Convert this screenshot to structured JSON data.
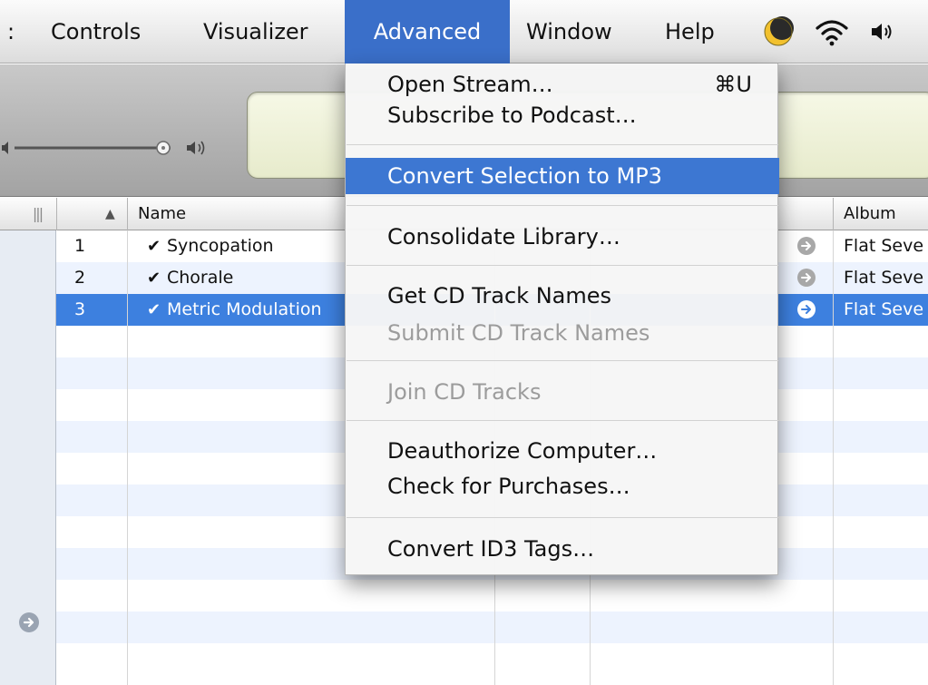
{
  "menubar": {
    "partial_item": ":",
    "items": [
      "Controls",
      "Visualizer",
      "Advanced",
      "Window",
      "Help"
    ],
    "active_item": "Advanced",
    "status_icons": [
      "eclipse-menu-icon",
      "wifi-icon",
      "volume-icon"
    ]
  },
  "advanced_menu": {
    "open_stream": {
      "label": "Open Stream…",
      "shortcut": "⌘U"
    },
    "subscribe_podcast": {
      "label": "Subscribe to Podcast…"
    },
    "convert_selection": {
      "label": "Convert Selection to MP3",
      "highlighted": true
    },
    "consolidate_library": {
      "label": "Consolidate Library…"
    },
    "get_cd_track_names": {
      "label": "Get CD Track Names"
    },
    "submit_cd_track_names": {
      "label": "Submit CD Track Names",
      "disabled": true
    },
    "join_cd_tracks": {
      "label": "Join CD Tracks",
      "disabled": true
    },
    "deauthorize": {
      "label": "Deauthorize Computer…"
    },
    "check_purchases": {
      "label": "Check for Purchases…"
    },
    "convert_id3": {
      "label": "Convert ID3 Tags…"
    }
  },
  "track_list": {
    "columns": {
      "sort_indicator": "▲",
      "name": "Name",
      "album": "Album"
    },
    "rows": [
      {
        "num": "1",
        "checked": "✔",
        "name": "Syncopation",
        "album": "Flat Seve"
      },
      {
        "num": "2",
        "checked": "✔",
        "name": "Chorale",
        "album": "Flat Seve"
      },
      {
        "num": "3",
        "checked": "✔",
        "name": "Metric Modulation",
        "album": "Flat Seve",
        "selected": true
      }
    ]
  },
  "colors": {
    "menu_highlight": "#3d77d2",
    "selected_row": "#3d80df",
    "alt_row": "#edf3fe"
  }
}
